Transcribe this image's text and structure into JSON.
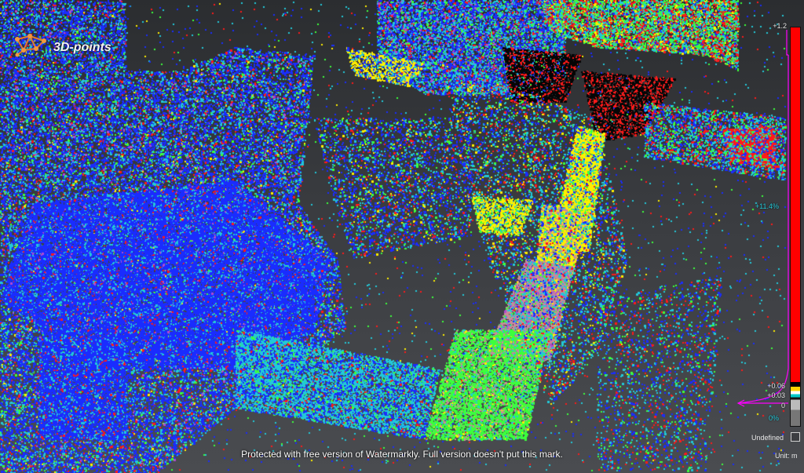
{
  "logo": {
    "text": "3D-points"
  },
  "color_scale": {
    "top_label": "+1.2",
    "mid_percent": "+11.4%",
    "tick_upper": "+0.06",
    "tick_lower": "+0.03",
    "tick_zero": "0",
    "bottom_percent": "0%",
    "undefined_label": "Undefined",
    "unit_label": "Unit: m",
    "colors": {
      "high": "#ff0000",
      "upper_mid": "#ffd400",
      "mid": "#00c8c8",
      "low": "#bbbbbb",
      "curve": "#ff00ff"
    }
  },
  "watermark": "Protected with free version of Watermarkly. Full version doesn't put this mark.",
  "palette": {
    "blue": "#1a2cff",
    "cyan": "#22c8d8",
    "green": "#3cff3c",
    "yellow": "#ffef00",
    "red": "#ff1a1a",
    "magenta": "#b04ad0",
    "pink": "#c88a9a",
    "black": "#050505"
  }
}
